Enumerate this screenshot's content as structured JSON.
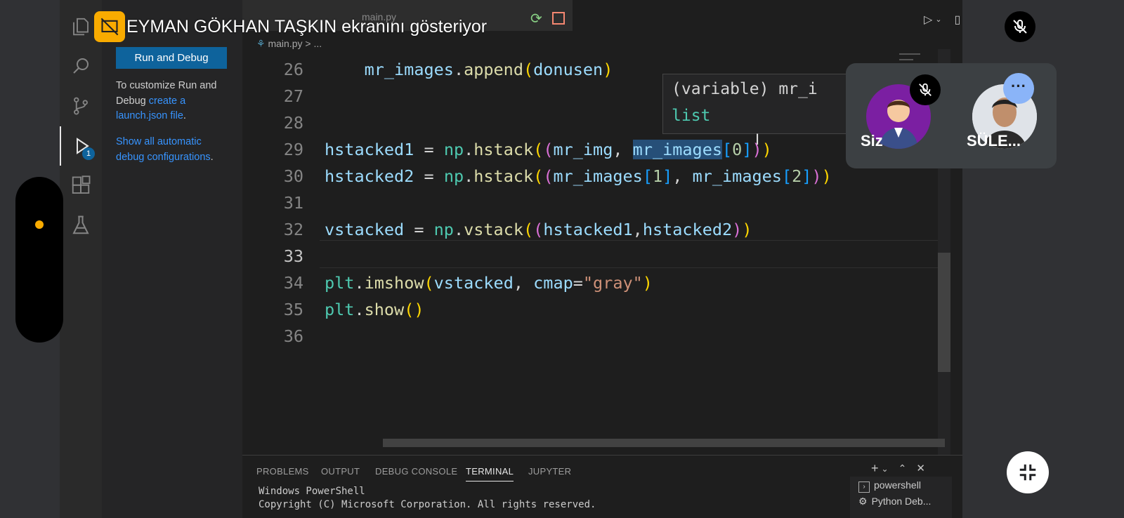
{
  "presenter_banner": "EYMAN GÖKHAN TAŞKIN ekranını gösteriyor",
  "vscode": {
    "sidebar": {
      "run_button": "Run and Debug",
      "customize_prefix": "To customize Run and",
      "customize_line2_prefix": "Debug ",
      "create_link": "create a",
      "launch_link": "launch.json file",
      "period1": ".",
      "show_all_link_line1": "Show all automatic",
      "show_all_link_line2": "debug configurations",
      "period2": ".",
      "debug_badge": "1"
    },
    "breadcrumb": {
      "file": "main.py",
      "separator": ">",
      "more": "..."
    },
    "tab_label": "main.py",
    "code": {
      "line_numbers": [
        "26",
        "27",
        "28",
        "29",
        "30",
        "31",
        "32",
        "33",
        "34",
        "35",
        "36"
      ],
      "current_line": "33"
    },
    "hover": {
      "line1": "(variable) mr_i",
      "line2": "list"
    },
    "panel": {
      "tabs": [
        "PROBLEMS",
        "OUTPUT",
        "DEBUG CONSOLE",
        "TERMINAL",
        "JUPYTER"
      ],
      "active_tab": "TERMINAL",
      "terminal_lines": [
        "Windows PowerShell",
        "Copyright (C) Microsoft Corporation. All rights reserved."
      ],
      "terminals": [
        "powershell",
        "Python Deb..."
      ]
    }
  },
  "participants": [
    {
      "name": "Siz",
      "muted": true
    },
    {
      "name": "SÜLE..."
    }
  ],
  "colors": {
    "accent_button": "#0e639c",
    "present_icon": "#f9ab00",
    "avatar_bg": "#7b1fa2",
    "more_button": "#8ab4f8"
  }
}
